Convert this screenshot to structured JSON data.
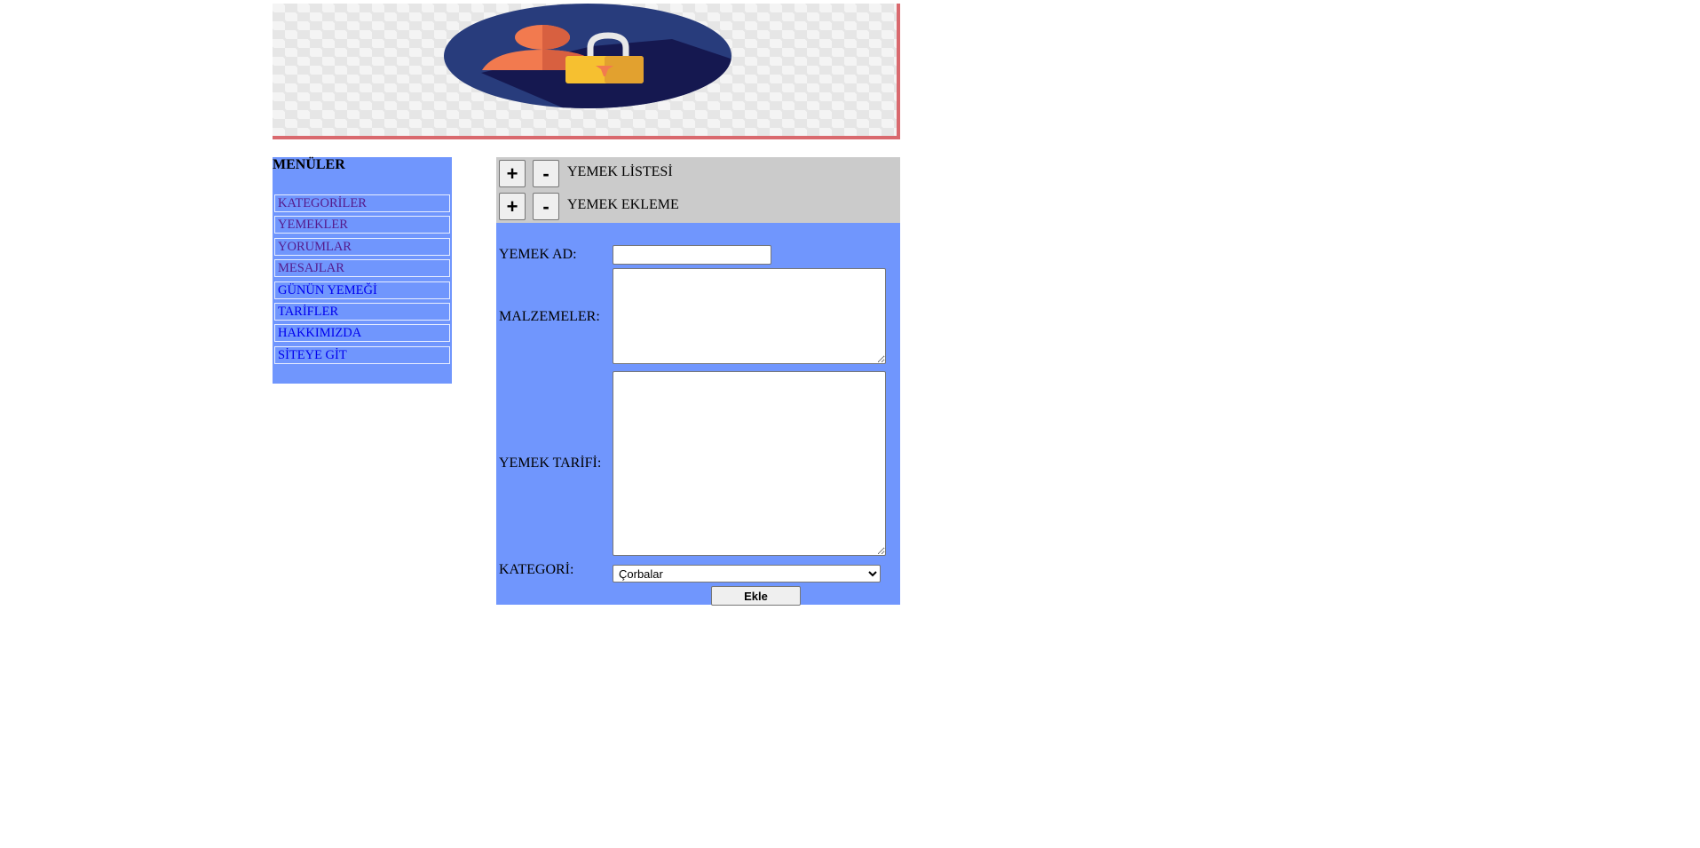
{
  "header": {
    "banner_icon": "user-lock-icon",
    "colors": {
      "banner_border": "#d9696e",
      "circle": "#283c7c",
      "user": "#f27a4f",
      "lock": "#f6c030"
    }
  },
  "sidebar": {
    "title": "MENÜLER",
    "background": "#7096fd",
    "items": [
      {
        "label": "KATEGORİLER",
        "state": "visited"
      },
      {
        "label": "YEMEKLER",
        "state": "visited"
      },
      {
        "label": "YORUMLAR",
        "state": "visited"
      },
      {
        "label": "MESAJLAR",
        "state": "visited"
      },
      {
        "label": "GÜNÜN YEMEĞİ",
        "state": "link"
      },
      {
        "label": "TARİFLER",
        "state": "link"
      },
      {
        "label": "HAKKIMIZDA",
        "state": "link"
      },
      {
        "label": "SİTEYE GİT",
        "state": "link"
      }
    ]
  },
  "panel": {
    "sections": [
      {
        "plus_label": "+",
        "minus_label": "-",
        "title": "YEMEK LİSTESİ"
      },
      {
        "plus_label": "+",
        "minus_label": "-",
        "title": "YEMEK EKLEME"
      }
    ],
    "form": {
      "yemek_ad_label": "YEMEK AD:",
      "yemek_ad_value": "",
      "malzemeler_label": "MALZEMELER:",
      "malzemeler_value": "",
      "tarif_label": "YEMEK TARİFİ:",
      "tarif_value": "",
      "kategori_label": "KATEGORİ:",
      "kategori_selected": "Çorbalar",
      "submit_label": "Ekle"
    }
  }
}
